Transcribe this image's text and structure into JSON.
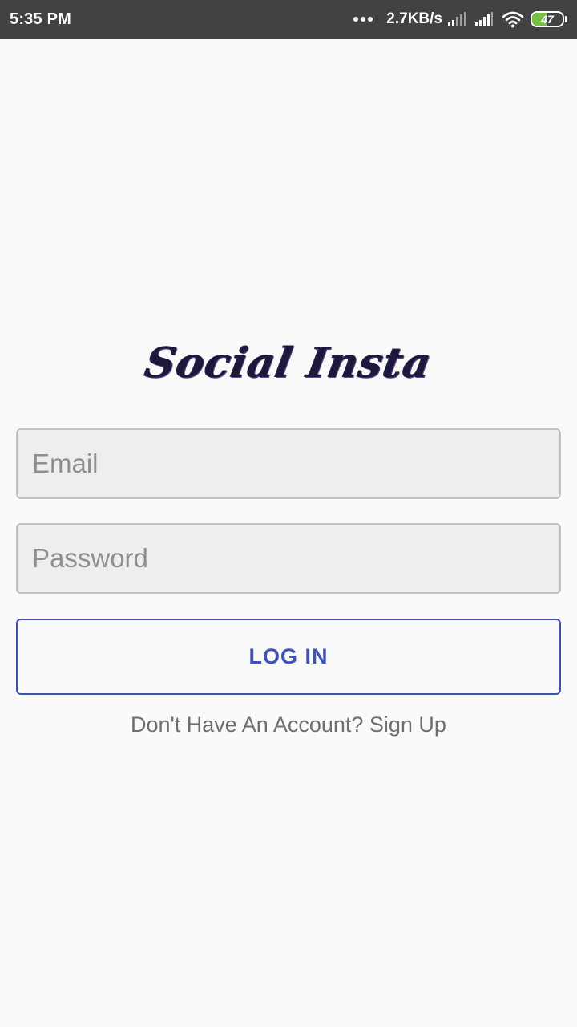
{
  "status_bar": {
    "time": "5:35 PM",
    "network_speed": "2.7KB/s",
    "battery_level": "47",
    "battery_fraction": 0.47,
    "icons": [
      "more-dots-icon",
      "signal-icon",
      "signal-icon",
      "wifi-icon",
      "battery-icon"
    ]
  },
  "app": {
    "logo_text": "Social Insta"
  },
  "login_form": {
    "email_placeholder": "Email",
    "password_placeholder": "Password",
    "login_label": "LOG IN",
    "signup_text": "Don't Have An Account? Sign Up"
  },
  "colors": {
    "accent": "#3f51b5",
    "status_bar": "#424242",
    "background": "#fafafa",
    "field_background": "#eeeeee",
    "battery": "#76c043"
  }
}
